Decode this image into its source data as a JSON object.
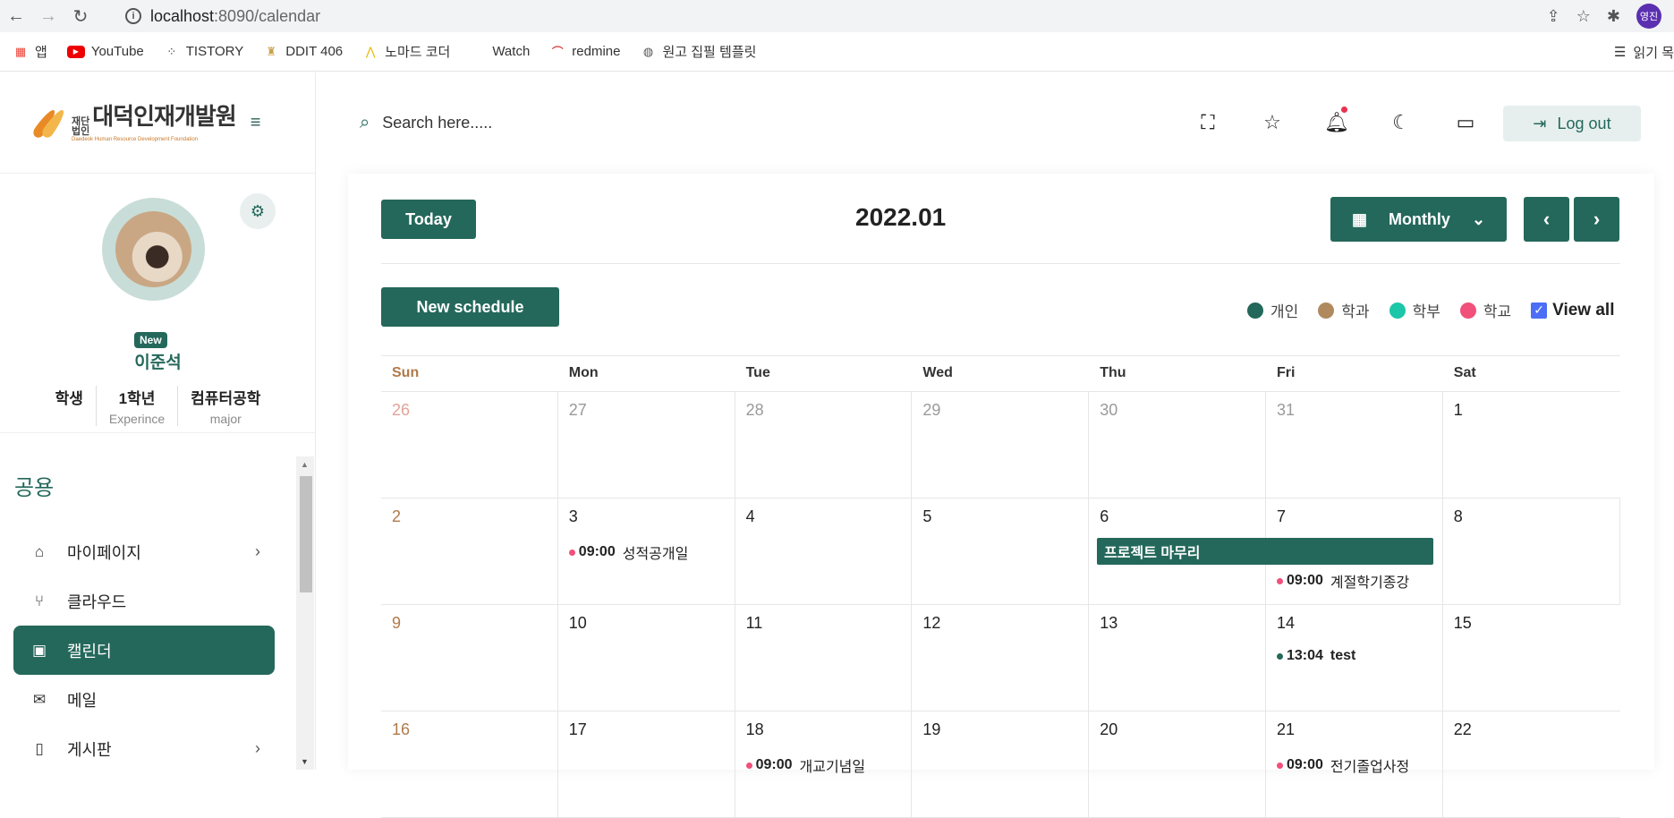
{
  "browser": {
    "url_host": "localhost",
    "url_rest": ":8090/calendar",
    "profile_initials": "영진",
    "bookmarks": [
      {
        "label": "앱",
        "icon": "apps-grid-icon"
      },
      {
        "label": "YouTube",
        "icon": "youtube-icon"
      },
      {
        "label": "TISTORY",
        "icon": "tistory-icon"
      },
      {
        "label": "DDIT 406",
        "icon": "ddit-icon"
      },
      {
        "label": "노마드 코더",
        "icon": "nomad-icon"
      },
      {
        "label": "Watch",
        "icon": "apple-icon"
      },
      {
        "label": "redmine",
        "icon": "redmine-icon"
      },
      {
        "label": "원고 집필 템플릿",
        "icon": "globe-icon"
      }
    ],
    "reading_list": "읽기 목"
  },
  "sidebar": {
    "logo_small": "재단\n법인",
    "logo_big": "대덕인재개발원",
    "logo_sub": "Daedeok Human Resource Development Foundation",
    "badge": "New",
    "user_name": "이준석",
    "stats": [
      {
        "value": "학생",
        "key": ""
      },
      {
        "value": "1학년",
        "key": "Experince"
      },
      {
        "value": "컴퓨터공학",
        "key": "major"
      }
    ],
    "section": "공용",
    "menu": [
      {
        "label": "마이페이지",
        "icon": "home-icon",
        "chevron": true,
        "active": false
      },
      {
        "label": "클라우드",
        "icon": "git-branch-icon",
        "chevron": false,
        "active": false
      },
      {
        "label": "캘린더",
        "icon": "calendar-icon",
        "chevron": false,
        "active": true
      },
      {
        "label": "메일",
        "icon": "mail-icon",
        "chevron": false,
        "active": false
      },
      {
        "label": "게시판",
        "icon": "book-icon",
        "chevron": true,
        "active": false
      }
    ]
  },
  "header": {
    "search_placeholder": "Search here.....",
    "logout": "Log out"
  },
  "calendar": {
    "today": "Today",
    "month": "2022.01",
    "view": "Monthly",
    "new_schedule": "New schedule",
    "legend": [
      {
        "label": "개인",
        "color": "#24685b"
      },
      {
        "label": "학과",
        "color": "#b08a5e"
      },
      {
        "label": "학부",
        "color": "#1cc6a8"
      },
      {
        "label": "학교",
        "color": "#f0507a"
      }
    ],
    "view_all": "View all",
    "days": [
      "Sun",
      "Mon",
      "Tue",
      "Wed",
      "Thu",
      "Fri",
      "Sat"
    ],
    "weeks": [
      [
        "26",
        "27",
        "28",
        "29",
        "30",
        "31",
        "1"
      ],
      [
        "2",
        "3",
        "4",
        "5",
        "6",
        "7",
        "8"
      ],
      [
        "9",
        "10",
        "11",
        "12",
        "13",
        "14",
        "15"
      ],
      [
        "16",
        "17",
        "18",
        "19",
        "20",
        "21",
        "22"
      ]
    ],
    "events": {
      "e1_time": "09:00",
      "e1_title": "성적공개일",
      "bar_title": "프로젝트 마무리",
      "e2_time": "09:00",
      "e2_title": "계절학기종강",
      "e3_time": "13:04",
      "e3_title": "test",
      "e4_time": "09:00",
      "e4_title": "개교기념일",
      "e5_time": "09:00",
      "e5_title": "전기졸업사정"
    }
  }
}
